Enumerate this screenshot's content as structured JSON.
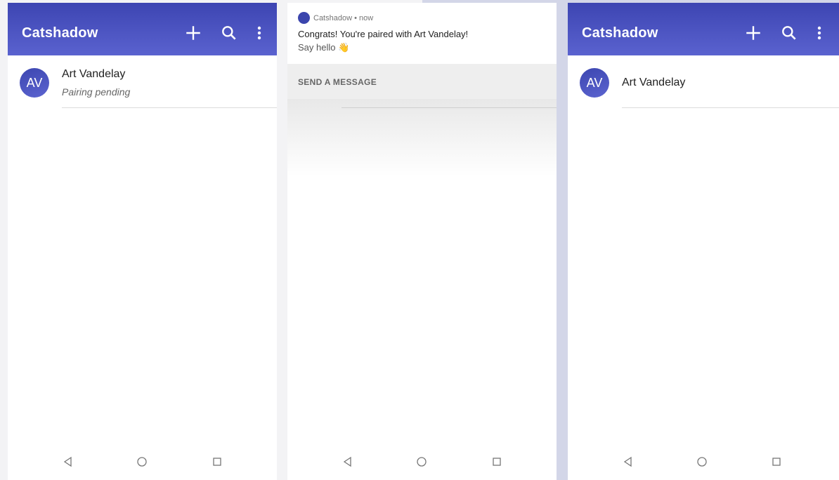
{
  "app": {
    "title": "Catshadow"
  },
  "screens": [
    {
      "contact": {
        "initials": "AV",
        "name": "Art Vandelay",
        "status": "Pairing pending"
      }
    },
    {
      "notification": {
        "header": "Catshadow • now",
        "title": "Congrats! You're paired with Art Vandelay!",
        "body": "Say hello 👋",
        "action": "SEND A MESSAGE"
      }
    },
    {
      "contact": {
        "initials": "AV",
        "name": "Art Vandelay"
      }
    }
  ],
  "icons": {
    "add": "add-icon",
    "search": "search-icon",
    "more": "more-vert-icon",
    "back": "back-icon",
    "home": "home-icon",
    "recents": "recents-icon"
  },
  "colors": {
    "primary": "#3d45b2",
    "primary_light": "#5a62cf",
    "avatar": "#4a52c0"
  }
}
